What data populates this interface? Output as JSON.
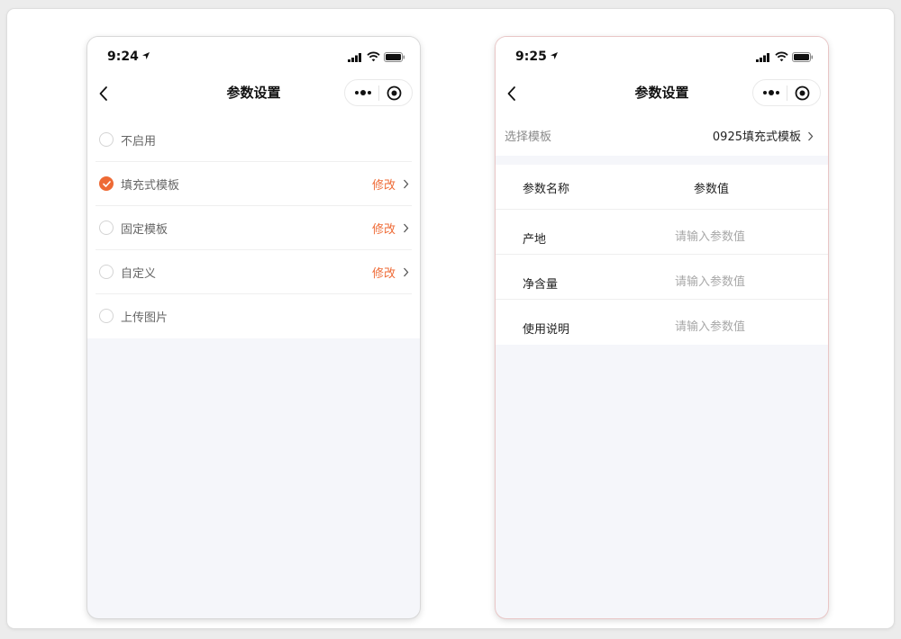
{
  "left_screen": {
    "status": {
      "time": "9:24"
    },
    "nav": {
      "title": "参数设置"
    },
    "options": [
      {
        "label": "不启用",
        "checked": false,
        "action": ""
      },
      {
        "label": "填充式模板",
        "checked": true,
        "action": "修改"
      },
      {
        "label": "固定模板",
        "checked": false,
        "action": "修改"
      },
      {
        "label": "自定义",
        "checked": false,
        "action": "修改"
      },
      {
        "label": "上传图片",
        "checked": false,
        "action": ""
      }
    ]
  },
  "right_screen": {
    "status": {
      "time": "9:25"
    },
    "nav": {
      "title": "参数设置"
    },
    "template": {
      "label": "选择模板",
      "value": "0925填充式模板"
    },
    "table": {
      "header_name": "参数名称",
      "header_value": "参数值",
      "rows": [
        {
          "name": "产地",
          "placeholder": "请输入参数值"
        },
        {
          "name": "净含量",
          "placeholder": "请输入参数值"
        },
        {
          "name": "使用说明",
          "placeholder": "请输入参数值"
        }
      ]
    }
  },
  "icons": [
    "location-arrow-icon",
    "signal-icon",
    "wifi-icon",
    "battery-icon",
    "back-chevron-icon",
    "more-dots-icon",
    "target-icon",
    "chevron-right-icon",
    "check-icon"
  ],
  "colors": {
    "accent": "#ee6a35",
    "page_bg": "#f5f6fa",
    "muted_text": "#8a8a8a",
    "placeholder": "#a8a8a8"
  }
}
